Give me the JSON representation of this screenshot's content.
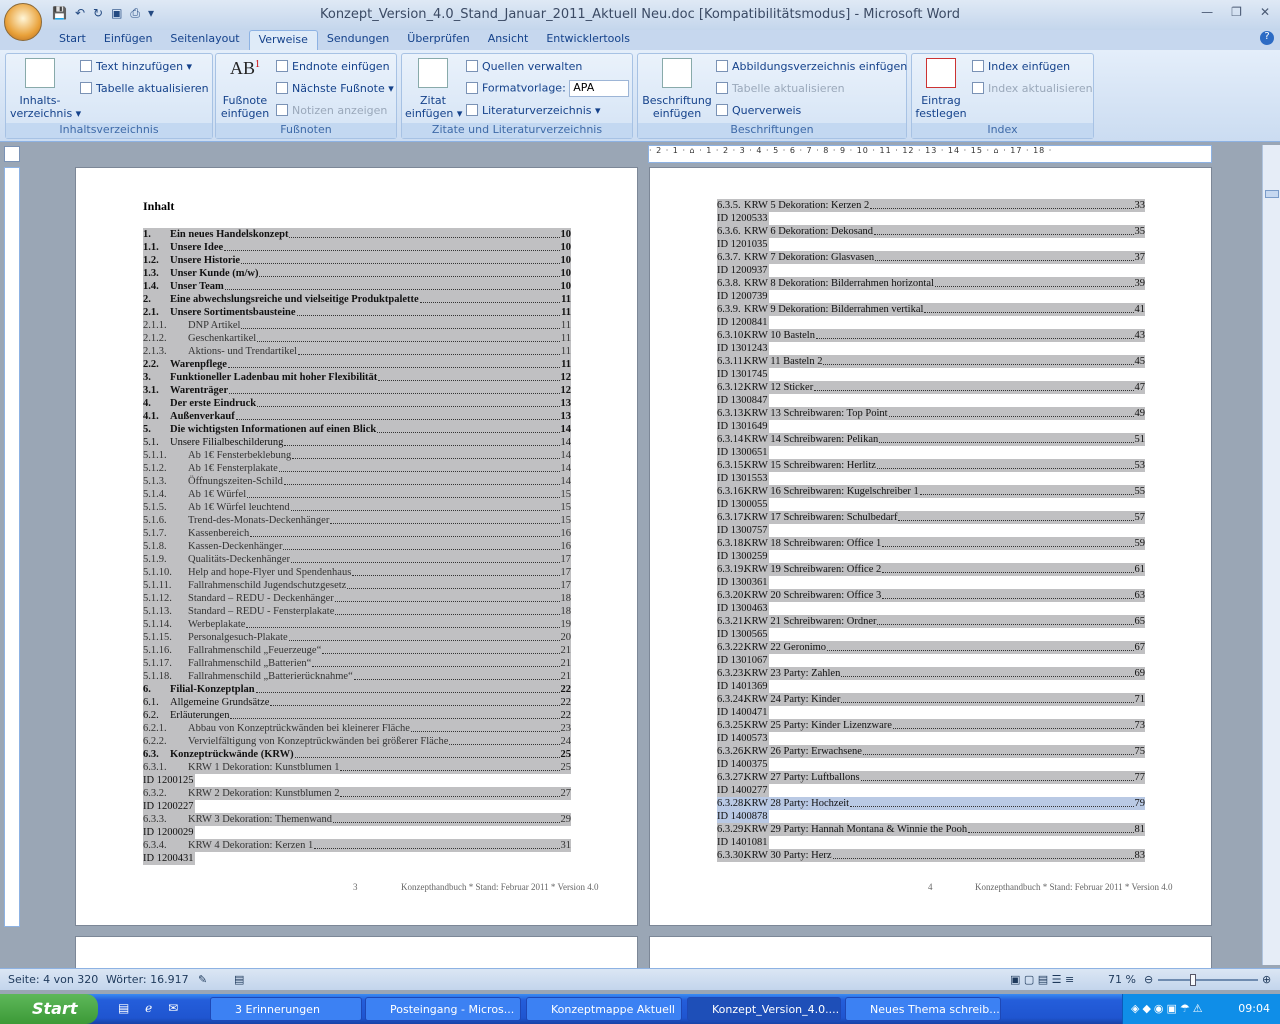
{
  "window": {
    "title": "Konzept_Version_4.0_Stand_Januar_2011_Aktuell Neu.doc [Kompatibilitätsmodus] - Microsoft Word"
  },
  "tabs": [
    "Start",
    "Einfügen",
    "Seitenlayout",
    "Verweise",
    "Sendungen",
    "Überprüfen",
    "Ansicht",
    "Entwicklertools"
  ],
  "active_tab": "Verweise",
  "ribbon": {
    "toc": {
      "label": "Inhaltsverzeichnis",
      "big": "Inhalts-\nverzeichnis ▾",
      "add_text": "Text hinzufügen ▾",
      "update_table": "Tabelle aktualisieren"
    },
    "footnotes": {
      "label": "Fußnoten",
      "big": "Fußnote\neinfügen",
      "endnote": "Endnote einfügen",
      "next": "Nächste Fußnote ▾",
      "show": "Notizen anzeigen"
    },
    "citations": {
      "label": "Zitate und Literaturverzeichnis",
      "big": "Zitat\neinfügen ▾",
      "manage": "Quellen verwalten",
      "style_label": "Formatvorlage:",
      "style_value": "APA",
      "bibliography": "Literaturverzeichnis ▾"
    },
    "captions": {
      "label": "Beschriftungen",
      "big": "Beschriftung\neinfügen",
      "figures": "Abbildungsverzeichnis einfügen",
      "update": "Tabelle aktualisieren",
      "crossref": "Querverweis"
    },
    "index": {
      "label": "Index",
      "big": "Eintrag\nfestlegen",
      "insert": "Index einfügen",
      "update": "Index aktualisieren"
    }
  },
  "ruler": "· 2 · 1 · ⌂ · 1 · 2 · 3 · 4 · 5 · 6 · 7 · 8 · 9 · 10 · 11 · 12 · 13 · 14 · 15 · ⌂ · 17 · 18 ·",
  "page3": {
    "heading": "Inhalt",
    "page_no": "3",
    "footer": "Konzepthandbuch * Stand: Februar 2011 * Version 4.0",
    "entries": [
      {
        "n": "1.",
        "t": "Ein neues Handelskonzept",
        "p": "10",
        "b": true
      },
      {
        "n": "1.1.",
        "t": "Unsere Idee",
        "p": "10",
        "b": true
      },
      {
        "n": "1.2.",
        "t": "Unsere Historie",
        "p": "10",
        "b": true
      },
      {
        "n": "1.3.",
        "t": "Unser Kunde (m/w)",
        "p": "10",
        "b": true
      },
      {
        "n": "1.4.",
        "t": "Unser Team",
        "p": "10",
        "b": true
      },
      {
        "n": "2.",
        "t": "Eine abwechslungsreiche und vielseitige Produktpalette",
        "p": "11",
        "b": true
      },
      {
        "n": "2.1.",
        "t": "Unsere Sortimentsbausteine",
        "p": "11",
        "b": true
      },
      {
        "n": "2.1.1.",
        "t": "DNP Artikel",
        "p": "11",
        "l3": true
      },
      {
        "n": "2.1.2.",
        "t": "Geschenkartikel",
        "p": "11",
        "l3": true
      },
      {
        "n": "2.1.3.",
        "t": "Aktions- und Trendartikel",
        "p": "11",
        "l3": true
      },
      {
        "n": "2.2.",
        "t": "Warenpflege",
        "p": "11",
        "b": true
      },
      {
        "n": "3.",
        "t": "Funktioneller Ladenbau mit hoher Flexibilität",
        "p": "12",
        "b": true
      },
      {
        "n": "3.1.",
        "t": "Warenträger",
        "p": "12",
        "b": true
      },
      {
        "n": "4.",
        "t": "Der erste Eindruck",
        "p": "13",
        "b": true
      },
      {
        "n": "4.1.",
        "t": "Außenverkauf",
        "p": "13",
        "b": true
      },
      {
        "n": "5.",
        "t": "Die wichtigsten Informationen auf einen Blick",
        "p": "14",
        "b": true
      },
      {
        "n": "5.1.",
        "t": "Unsere Filialbeschilderung",
        "p": "14"
      },
      {
        "n": "5.1.1.",
        "t": "Ab 1€ Fensterbeklebung",
        "p": "14",
        "l3": true
      },
      {
        "n": "5.1.2.",
        "t": "Ab 1€ Fensterplakate",
        "p": "14",
        "l3": true
      },
      {
        "n": "5.1.3.",
        "t": "Öffnungszeiten-Schild",
        "p": "14",
        "l3": true
      },
      {
        "n": "5.1.4.",
        "t": "Ab 1€ Würfel",
        "p": "15",
        "l3": true
      },
      {
        "n": "5.1.5.",
        "t": "Ab 1€ Würfel leuchtend",
        "p": "15",
        "l3": true
      },
      {
        "n": "5.1.6.",
        "t": "Trend-des-Monats-Deckenhänger",
        "p": "15",
        "l3": true
      },
      {
        "n": "5.1.7.",
        "t": "Kassenbereich",
        "p": "16",
        "l3": true
      },
      {
        "n": "5.1.8.",
        "t": "Kassen-Deckenhänger",
        "p": "16",
        "l3": true
      },
      {
        "n": "5.1.9.",
        "t": "Qualitäts-Deckenhänger",
        "p": "17",
        "l3": true
      },
      {
        "n": "5.1.10.",
        "t": "Help and hope-Flyer und Spendenhaus",
        "p": "17",
        "l3": true
      },
      {
        "n": "5.1.11.",
        "t": "Fallrahmenschild Jugendschutzgesetz",
        "p": "17",
        "l3": true
      },
      {
        "n": "5.1.12.",
        "t": "Standard – REDU - Deckenhänger",
        "p": "18",
        "l3": true
      },
      {
        "n": "5.1.13.",
        "t": "Standard – REDU - Fensterplakate",
        "p": "18",
        "l3": true
      },
      {
        "n": "5.1.14.",
        "t": "Werbeplakate",
        "p": "19",
        "l3": true
      },
      {
        "n": "5.1.15.",
        "t": "Personalgesuch-Plakate",
        "p": "20",
        "l3": true
      },
      {
        "n": "5.1.16.",
        "t": "Fallrahmenschild „Feuerzeuge“",
        "p": "21",
        "l3": true
      },
      {
        "n": "5.1.17.",
        "t": "Fallrahmenschild „Batterien“",
        "p": "21",
        "l3": true
      },
      {
        "n": "5.1.18.",
        "t": "Fallrahmenschild „Batterierücknahme“",
        "p": "21",
        "l3": true
      },
      {
        "n": "6.",
        "t": "Filial-Konzeptplan",
        "p": "22",
        "b": true
      },
      {
        "n": "6.1.",
        "t": "Allgemeine Grundsätze",
        "p": "22"
      },
      {
        "n": "6.2.",
        "t": "Erläuterungen",
        "p": "22"
      },
      {
        "n": "6.2.1.",
        "t": "Abbau von Konzeptrückwänden bei kleinerer Fläche",
        "p": "23",
        "l3": true
      },
      {
        "n": "6.2.2.",
        "t": "Vervielfältigung von Konzeptrückwänden bei größerer Fläche",
        "p": "24",
        "l3": true
      },
      {
        "n": "6.3.",
        "t": "Konzeptrückwände (KRW)",
        "p": "25",
        "b": true
      },
      {
        "n": "6.3.1.",
        "t": "KRW 1 Dekoration: Kunstblumen 1",
        "p": "25",
        "l3": true,
        "id": "ID 1200125"
      },
      {
        "n": "6.3.2.",
        "t": "KRW 2 Dekoration: Kunstblumen 2",
        "p": "27",
        "l3": true,
        "id": "ID 1200227"
      },
      {
        "n": "6.3.3.",
        "t": "KRW 3 Dekoration: Themenwand",
        "p": "29",
        "l3": true,
        "id": "ID 1200029"
      },
      {
        "n": "6.3.4.",
        "t": "KRW 4 Dekoration: Kerzen 1",
        "p": "31",
        "l3": true,
        "id": "ID 1200431"
      }
    ]
  },
  "page4": {
    "page_no": "4",
    "footer": "Konzepthandbuch * Stand: Februar 2011 * Version 4.0",
    "entries": [
      {
        "n": "6.3.5.",
        "t": "KRW 5 Dekoration: Kerzen 2",
        "p": "33",
        "id": "ID 1200533"
      },
      {
        "n": "6.3.6.",
        "t": "KRW 6 Dekoration: Dekosand",
        "p": "35",
        "id": "ID 1201035"
      },
      {
        "n": "6.3.7.",
        "t": "KRW 7 Dekoration: Glasvasen",
        "p": "37",
        "id": "ID 1200937"
      },
      {
        "n": "6.3.8.",
        "t": "KRW 8 Dekoration: Bilderrahmen horizontal",
        "p": "39",
        "id": "ID 1200739"
      },
      {
        "n": "6.3.9.",
        "t": "KRW 9 Dekoration: Bilderrahmen vertikal",
        "p": "41",
        "id": "ID 1200841"
      },
      {
        "n": "6.3.10.",
        "t": "KRW 10 Basteln",
        "p": "43",
        "id": "ID 1301243"
      },
      {
        "n": "6.3.11.",
        "t": "KRW 11 Basteln 2",
        "p": "45",
        "id": "ID 1301745"
      },
      {
        "n": "6.3.12.",
        "t": "KRW 12 Sticker",
        "p": "47",
        "id": "ID 1300847"
      },
      {
        "n": "6.3.13.",
        "t": "KRW 13 Schreibwaren: Top Point",
        "p": "49",
        "id": "ID 1301649"
      },
      {
        "n": "6.3.14",
        "t": "KRW 14 Schreibwaren: Pelikan",
        "p": "51",
        "id": "ID 1300651"
      },
      {
        "n": "6.3.15.",
        "t": "KRW 15 Schreibwaren: Herlitz",
        "p": "53",
        "id": "ID 1301553"
      },
      {
        "n": "6.3.16.",
        "t": "KRW 16 Schreibwaren: Kugelschreiber 1",
        "p": "55",
        "id": "ID 1300055"
      },
      {
        "n": "6.3.17.",
        "t": "KRW 17 Schreibwaren: Schulbedarf",
        "p": "57",
        "id": "ID 1300757"
      },
      {
        "n": "6.3.18.",
        "t": "KRW 18 Schreibwaren: Office 1",
        "p": "59",
        "id": "ID 1300259"
      },
      {
        "n": "6.3.19.",
        "t": "KRW 19 Schreibwaren: Office 2",
        "p": "61",
        "id": "ID 1300361"
      },
      {
        "n": "6.3.20.",
        "t": "KRW 20 Schreibwaren: Office 3",
        "p": "63",
        "id": "ID 1300463"
      },
      {
        "n": "6.3.21.",
        "t": "KRW 21 Schreibwaren: Ordner",
        "p": "65",
        "id": "ID 1300565"
      },
      {
        "n": "6.3.22.",
        "t": "KRW 22 Geronimo",
        "p": "67",
        "id": "ID 1301067"
      },
      {
        "n": "6.3.23.",
        "t": "KRW 23 Party: Zahlen",
        "p": "69",
        "id": "ID 1401369"
      },
      {
        "n": "6.3.24.",
        "t": "KRW 24 Party: Kinder",
        "p": "71",
        "id": "ID 1400471"
      },
      {
        "n": "6.3.25.",
        "t": "KRW 25 Party: Kinder Lizenzware",
        "p": "73",
        "id": "ID 1400573"
      },
      {
        "n": "6.3.26.",
        "t": "KRW 26 Party: Erwachsene",
        "p": "75",
        "id": "ID 1400375"
      },
      {
        "n": "6.3.27.",
        "t": "KRW 27 Party: Luftballons",
        "p": "77",
        "id": "ID 1400277"
      },
      {
        "n": "6.3.28.",
        "t": "KRW 28 Party: Hochzeit",
        "p": "79",
        "id": "ID 1400878",
        "sel": true
      },
      {
        "n": "6.3.29.",
        "t": "KRW 29 Party: Hannah Montana & Winnie the Pooh",
        "p": "81",
        "id": "ID 1401081"
      },
      {
        "n": "6.3.30.",
        "t": "KRW 30 Party: Herz",
        "p": "83"
      }
    ]
  },
  "status": {
    "page": "Seite: 4 von 320",
    "words": "Wörter: 16.917",
    "zoom": "71 %",
    "zoom_percent": 71
  },
  "taskbar": {
    "start": "Start",
    "tasks": [
      "3 Erinnerungen",
      "Posteingang - Micros...",
      "Konzeptmappe Aktuell",
      "Konzept_Version_4.0....",
      "Neues Thema schreib..."
    ],
    "active_task": 3,
    "clock": "09:04"
  }
}
